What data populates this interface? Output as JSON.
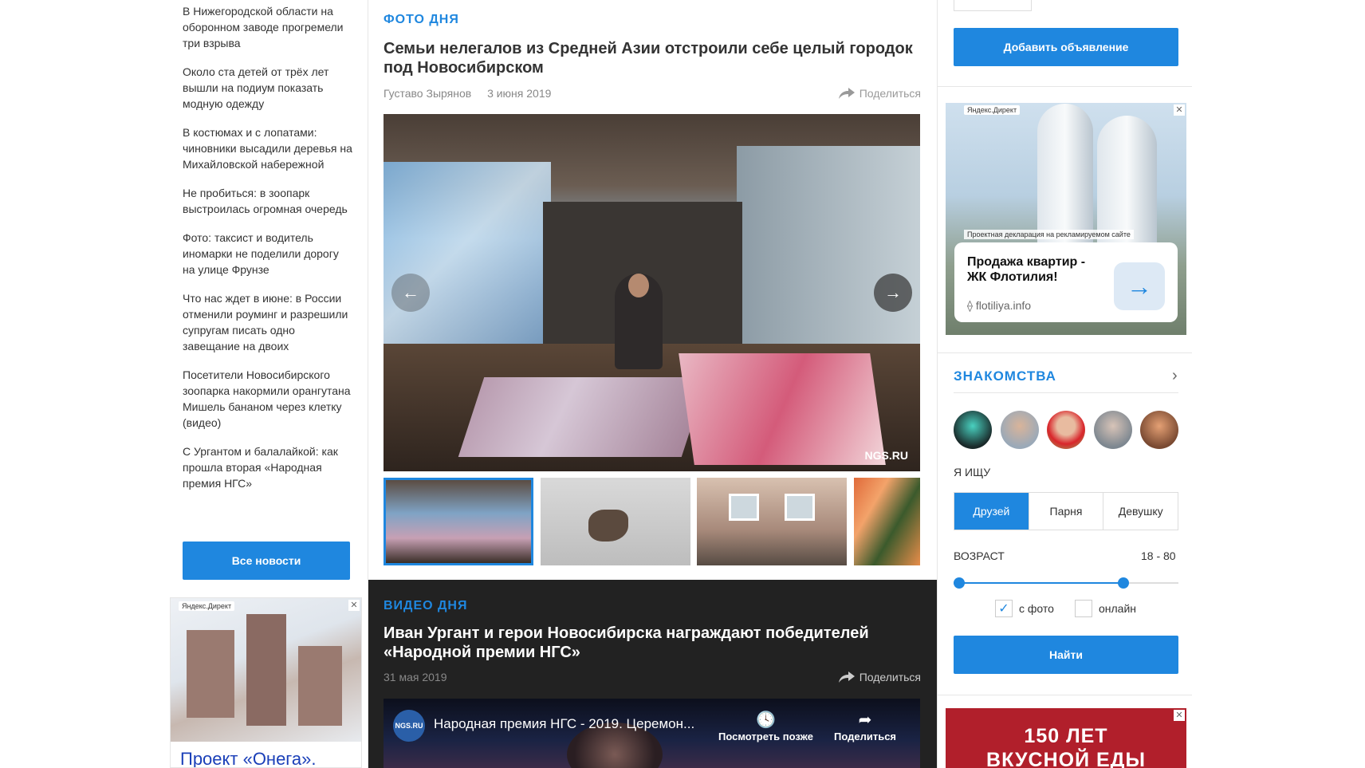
{
  "left_news": {
    "items": [
      "В Нижегородской области на оборонном заводе прогремели три взрыва",
      "Около ста детей от трёх лет вышли на подиум показать модную одежду",
      "В костюмах и с лопатами: чиновники высадили деревья на Михайловской набережной",
      "Не пробиться: в зоопарк выстроилась огромная очередь",
      "Фото: таксист и водитель иномарки не поделили дорогу на улице Фрунзе",
      "Что нас ждет в июне: в России отменили роуминг и разрешили супругам писать одно завещание на двоих",
      "Посетители Новосибирского зоопарка накормили орангутана Мишель бананом через клетку (видео)",
      "С Ургантом и балалайкой: как прошла вторая «Народная премия НГС»"
    ],
    "all_news_label": "Все новости"
  },
  "left_ad": {
    "label": "Яндекс.Директ",
    "close": "✕",
    "title": "Проект «Онега»."
  },
  "photo_day": {
    "tag": "ФОТО ДНЯ",
    "title": "Семьи нелегалов из Средней Азии отстроили себе целый городок под Новосибирском",
    "author": "Густаво Зырянов",
    "date": "3 июня 2019",
    "share_label": "Поделиться",
    "prev_icon": "←",
    "next_icon": "→",
    "watermark": "NGS.RU"
  },
  "video_day": {
    "tag": "ВИДЕО ДНЯ",
    "title": "Иван Ургант и герои Новосибирска награждают победителей «Народной премии НГС»",
    "date": "31 мая 2019",
    "share_label": "Поделиться",
    "channel_logo": "NGS.RU",
    "video_title": "Народная премия НГС - 2019. Церемон...",
    "watch_later": "Посмотреть позже",
    "share_player": "Поделиться"
  },
  "right_col": {
    "add_ad_label": "Добавить объявление",
    "ad": {
      "label": "Яндекс.Директ",
      "close": "✕",
      "declaration": "Проектная декларация на рекламируемом сайте",
      "title": "Продажа квартир - ЖК Флотилия!",
      "domain": "flotiliya.info",
      "arrow": "→"
    },
    "dating": {
      "title": "ЗНАКОМСТВА",
      "chevron": "›",
      "seeking_label": "Я ИЩУ",
      "options": [
        "Друзей",
        "Парня",
        "Девушку"
      ],
      "selected": "Друзей",
      "age_label": "ВОЗРАСТ",
      "age_range": "18 - 80",
      "age_min": 18,
      "age_max": 80,
      "with_photo_label": "с фото",
      "with_photo": true,
      "online_label": "онлайн",
      "online": false,
      "find_label": "Найти"
    },
    "ad2": {
      "close": "✕",
      "text_line1": "150 ЛЕТ",
      "text_line2": "ВКУСНОЙ ЕДЫ"
    }
  },
  "colors": {
    "accent": "#1f87df",
    "video_bg": "#222222",
    "ad_red": "#b11f2b"
  }
}
